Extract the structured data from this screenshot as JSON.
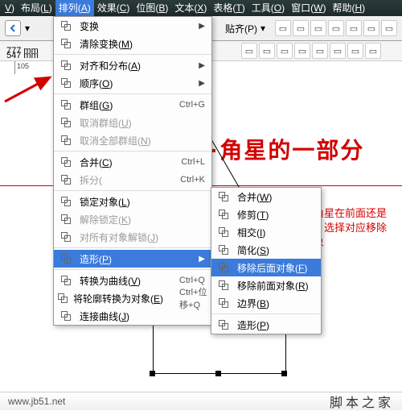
{
  "menubar": {
    "items": [
      {
        "pre": "",
        "ul": "V",
        "post": ")"
      },
      {
        "pre": "布局(",
        "ul": "L",
        "post": ")"
      },
      {
        "pre": "排列(",
        "ul": "A",
        "post": ")",
        "hl": true
      },
      {
        "pre": "效果(",
        "ul": "C",
        "post": ")"
      },
      {
        "pre": "位图(",
        "ul": "B",
        "post": ")"
      },
      {
        "pre": "文本(",
        "ul": "X",
        "post": ")"
      },
      {
        "pre": "表格(",
        "ul": "T",
        "post": ")"
      },
      {
        "pre": "工具(",
        "ul": "O",
        "post": ")"
      },
      {
        "pre": "窗口(",
        "ul": "W",
        "post": ")"
      },
      {
        "pre": "帮助(",
        "ul": "H",
        "post": ")"
      }
    ]
  },
  "toolbar": {
    "paste": "贴齐(P)"
  },
  "prop": {
    "w": "777 mm",
    "h": "547 mm"
  },
  "ruler": {
    "ticks": [
      "105"
    ]
  },
  "menu1": {
    "rows": [
      {
        "label": {
          "t": "变换",
          "u": ""
        },
        "sub": true
      },
      {
        "label": {
          "t": "清除变换(",
          "u": "M",
          "p": ")"
        }
      },
      {
        "sep": true
      },
      {
        "label": {
          "t": "对齐和分布(",
          "u": "A",
          "p": ")"
        },
        "sub": true
      },
      {
        "label": {
          "t": "顺序(",
          "u": "O",
          "p": ")"
        },
        "sub": true
      },
      {
        "sep": true
      },
      {
        "label": {
          "t": "群组(",
          "u": "G",
          "p": ")"
        },
        "short": "Ctrl+G"
      },
      {
        "label": {
          "t": "取消群组(",
          "u": "U",
          "p": ")"
        },
        "disabled": true
      },
      {
        "label": {
          "t": "取消全部群组(",
          "u": "N",
          "p": ")"
        },
        "disabled": true
      },
      {
        "sep": true
      },
      {
        "label": {
          "t": "合并(",
          "u": "C",
          "p": ")"
        },
        "short": "Ctrl+L"
      },
      {
        "label": {
          "t": "拆分(",
          "u": "",
          "p": ""
        },
        "short": "Ctrl+K",
        "disabled": true
      },
      {
        "sep": true
      },
      {
        "label": {
          "t": "锁定对象(",
          "u": "L",
          "p": ")"
        }
      },
      {
        "label": {
          "t": "解除锁定(",
          "u": "K",
          "p": ")"
        },
        "disabled": true
      },
      {
        "label": {
          "t": "对所有对象解锁(",
          "u": "J",
          "p": ")"
        },
        "disabled": true
      },
      {
        "sep": true
      },
      {
        "label": {
          "t": "造形(",
          "u": "P",
          "p": ")"
        },
        "sub": true,
        "hl": true
      },
      {
        "sep": true
      },
      {
        "label": {
          "t": "转换为曲线(",
          "u": "V",
          "p": ")"
        },
        "short": "Ctrl+Q"
      },
      {
        "label": {
          "t": "将轮廓转换为对象(",
          "u": "E",
          "p": ")"
        },
        "short": "Ctrl+位移+Q"
      },
      {
        "label": {
          "t": "连接曲线(",
          "u": "J",
          "p": ")"
        }
      }
    ]
  },
  "menu2": {
    "rows": [
      {
        "label": {
          "t": "合并(",
          "u": "W",
          "p": ")"
        }
      },
      {
        "label": {
          "t": "修剪(",
          "u": "T",
          "p": ")"
        }
      },
      {
        "label": {
          "t": "相交(",
          "u": "I",
          "p": ")"
        }
      },
      {
        "label": {
          "t": "简化(",
          "u": "S",
          "p": ")"
        }
      },
      {
        "label": {
          "t": "移除后面对象(",
          "u": "F",
          "p": ")"
        },
        "hl": true
      },
      {
        "label": {
          "t": "移除前面对象(",
          "u": "R",
          "p": ")"
        }
      },
      {
        "label": {
          "t": "边界(",
          "u": "B",
          "p": ")"
        }
      },
      {
        "sep": true
      },
      {
        "label": {
          "t": "造形(",
          "u": "P",
          "p": ")"
        }
      }
    ]
  },
  "canvas": {
    "bigtext": "·角星的一部分",
    "sidetext": "看五角星在前面还是后面，选择对应移除的对象"
  },
  "footer": {
    "site": "www.jb51.net",
    "brand": "脚本之家"
  }
}
